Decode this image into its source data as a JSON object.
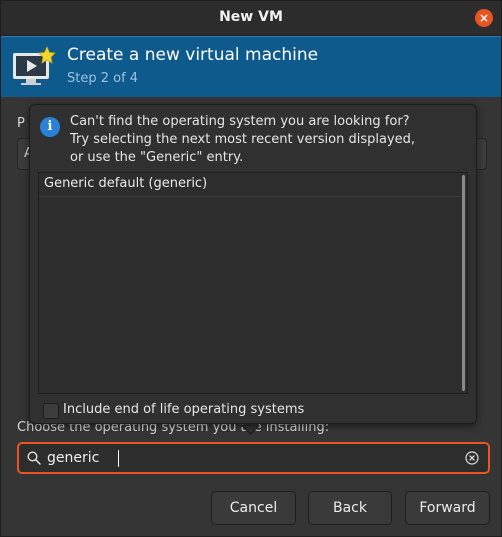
{
  "window": {
    "title": "New VM",
    "close_glyph": "×"
  },
  "header": {
    "title": "Create a new virtual machine",
    "step": "Step 2 of 4",
    "icon": "monitor-with-star-icon"
  },
  "background": {
    "label_top_partial": "P",
    "combo_partial": "A",
    "label_bottom": "Choose the operating system you are installing:"
  },
  "popover": {
    "info_icon": "info-icon",
    "info_lines": [
      "Can't find the operating system you are looking for?",
      "Try selecting the next most recent version displayed,",
      "or use the \"Generic\" entry."
    ],
    "os_list": [
      "Generic default (generic)"
    ],
    "eol_label": "Include end of life operating systems",
    "eol_checked": false
  },
  "search": {
    "value": "generic",
    "icon": "search-icon",
    "clear_icon": "clear-icon"
  },
  "buttons": {
    "cancel": "Cancel",
    "back": "Back",
    "forward": "Forward"
  },
  "colors": {
    "accent": "#e95420",
    "header_bg": "#0e5a8c",
    "info_blue": "#2a82d6"
  }
}
